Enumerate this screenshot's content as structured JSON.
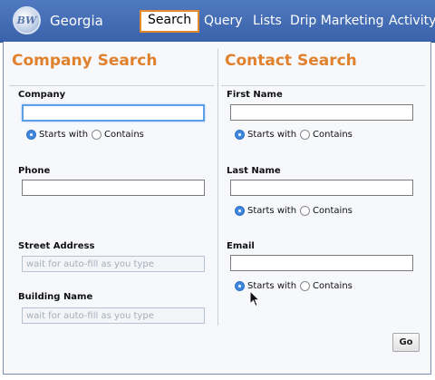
{
  "header": {
    "logo_text": "BW",
    "brand": "Georgia",
    "nav": [
      "Search",
      "Query",
      "Lists",
      "Drip Marketing",
      "Activity"
    ]
  },
  "company_search": {
    "title": "Company Search",
    "company_label": "Company",
    "starts_with": "Starts with",
    "contains": "Contains",
    "phone_label": "Phone",
    "street_label": "Street Address",
    "street_placeholder": "wait for auto-fill as you type",
    "building_label": "Building Name",
    "building_placeholder": "wait for auto-fill as you type"
  },
  "contact_search": {
    "title": "Contact Search",
    "first_name_label": "First Name",
    "last_name_label": "Last Name",
    "email_label": "Email",
    "starts_with": "Starts with",
    "contains": "Contains"
  },
  "go_label": "Go",
  "colors": {
    "header_blue": "#4a72b8",
    "accent_orange": "#e0812e",
    "radio_blue": "#3f86df"
  }
}
